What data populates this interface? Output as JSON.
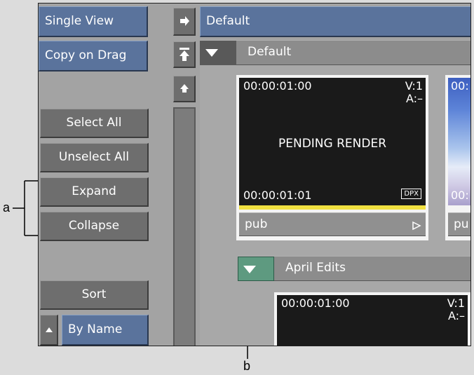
{
  "left_panel": {
    "single_view": "Single View",
    "copy_on_drag": "Copy on Drag",
    "select_all": "Select All",
    "unselect_all": "Unselect All",
    "expand": "Expand",
    "collapse": "Collapse",
    "sort": "Sort",
    "by_name": "By Name"
  },
  "header": {
    "library_name": "Default"
  },
  "library": {
    "title": "Default",
    "clips": [
      {
        "tc_in": "00:00:01:00",
        "tracks_v": "V:1",
        "tracks_a": "A:–",
        "status": "PENDING RENDER",
        "tc_out": "00:00:01:01",
        "format": "DPX",
        "name": "pub"
      },
      {
        "tc_in": "00:",
        "tc_out": "00:",
        "name": "pu"
      }
    ]
  },
  "folder": {
    "title": "April Edits",
    "clips": [
      {
        "tc_in": "00:00:01:00",
        "tracks_v": "V:1",
        "tracks_a": "A:–"
      }
    ]
  },
  "annotations": {
    "a": "a",
    "b": "b"
  },
  "colors": {
    "accent_green": "#5e9a80",
    "highlight_yellow": "#f0e040",
    "button_blue": "#5a739c"
  }
}
